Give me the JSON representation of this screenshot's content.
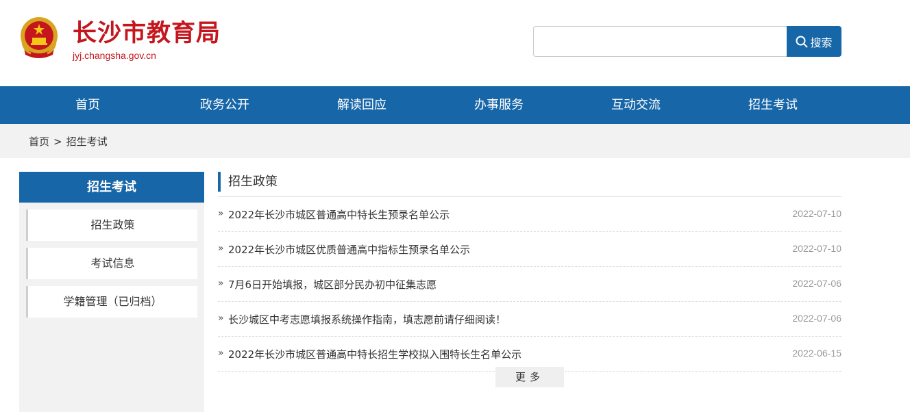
{
  "header": {
    "site_title": "长沙市教育局",
    "site_domain": "jyj.changsha.gov.cn",
    "emblem_icon": "national-emblem-icon",
    "search": {
      "value": "",
      "placeholder": "",
      "button_label": "搜索"
    }
  },
  "nav": {
    "items": [
      "首页",
      "政务公开",
      "解读回应",
      "办事服务",
      "互动交流",
      "招生考试"
    ]
  },
  "breadcrumb": {
    "home": "首页",
    "separator": ">",
    "current": "招生考试"
  },
  "sidebar": {
    "title": "招生考试",
    "items": [
      "招生政策",
      "考试信息",
      "学籍管理（已归档）"
    ]
  },
  "main": {
    "section_title": "招生政策",
    "bullet": "»",
    "news": [
      {
        "title": "2022年长沙市城区普通高中特长生预录名单公示",
        "date": "2022-07-10"
      },
      {
        "title": "2022年长沙市城区优质普通高中指标生预录名单公示",
        "date": "2022-07-10"
      },
      {
        "title": "7月6日开始填报，城区部分民办初中征集志愿",
        "date": "2022-07-06"
      },
      {
        "title": "长沙城区中考志愿填报系统操作指南，填志愿前请仔细阅读！",
        "date": "2022-07-06"
      },
      {
        "title": "2022年长沙市城区普通高中特长招生学校拟入围特长生名单公示",
        "date": "2022-06-15"
      }
    ],
    "more_label": "更多"
  },
  "colors": {
    "brand_red": "#c4161c",
    "primary_blue": "#1766a8",
    "gray_bg": "#f2f2f2"
  }
}
